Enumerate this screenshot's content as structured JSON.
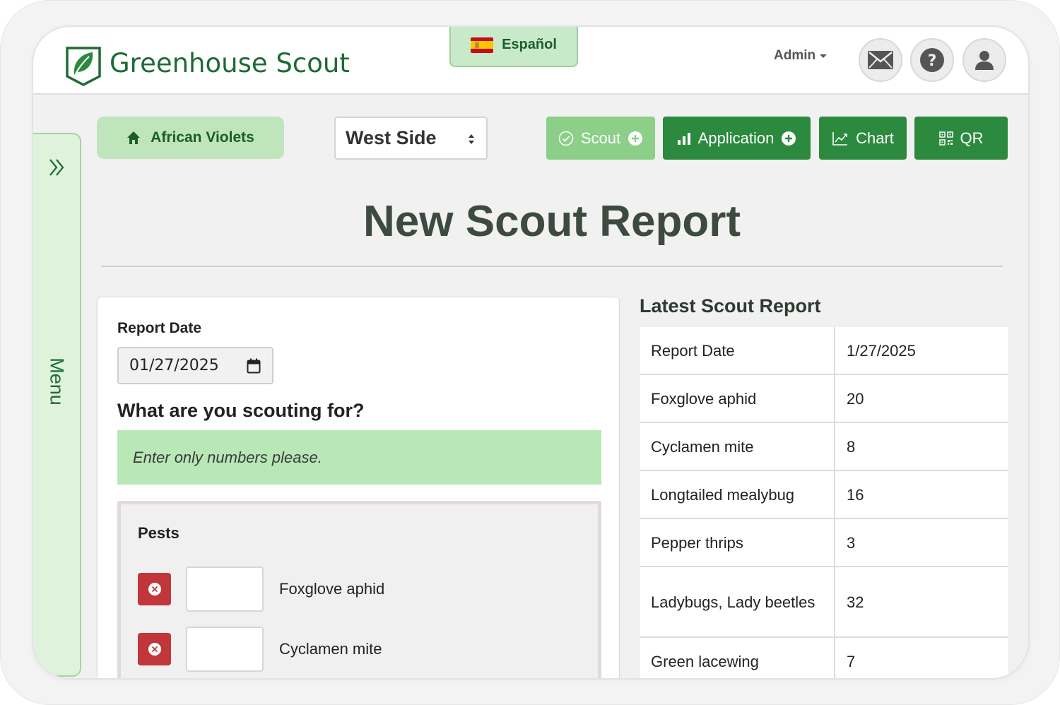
{
  "header": {
    "app_title": "Greenhouse Scout",
    "language_label": "Español",
    "admin_label": "Admin"
  },
  "sidebar": {
    "menu_label": "Menu"
  },
  "toolbar": {
    "crop_label": "African Violets",
    "location_value": "West Side",
    "scout_label": "Scout",
    "application_label": "Application",
    "chart_label": "Chart",
    "qr_label": "QR"
  },
  "page": {
    "title": "New Scout Report"
  },
  "form": {
    "report_date_label": "Report Date",
    "report_date_value": "01/27/2025",
    "question": "What are you scouting for?",
    "hint": "Enter only numbers please.",
    "pests_title": "Pests",
    "pests": [
      {
        "name": "Foxglove aphid",
        "value": ""
      },
      {
        "name": "Cyclamen mite",
        "value": ""
      }
    ]
  },
  "latest": {
    "title": "Latest Scout Report",
    "rows": [
      {
        "label": "Report Date",
        "value": "1/27/2025"
      },
      {
        "label": "Foxglove aphid",
        "value": "20"
      },
      {
        "label": "Cyclamen mite",
        "value": "8"
      },
      {
        "label": "Longtailed mealybug",
        "value": "16"
      },
      {
        "label": "Pepper thrips",
        "value": "3"
      },
      {
        "label": "Ladybugs, Lady beetles",
        "value": "32"
      },
      {
        "label": "Green lacewing",
        "value": "7"
      }
    ]
  },
  "colors": {
    "brand_green": "#1e6b34",
    "button_green": "#2b8a3e",
    "light_green": "#bfe5bc",
    "danger_red": "#c0363a"
  },
  "icons": [
    "leaf-logo-icon",
    "spain-flag-icon",
    "mail-icon",
    "help-icon",
    "user-icon",
    "double-chevron-right-icon",
    "home-icon",
    "check-circle-icon",
    "plus-circle-icon",
    "bar-chart-icon",
    "line-chart-icon",
    "qr-code-icon",
    "calendar-icon",
    "remove-icon"
  ]
}
